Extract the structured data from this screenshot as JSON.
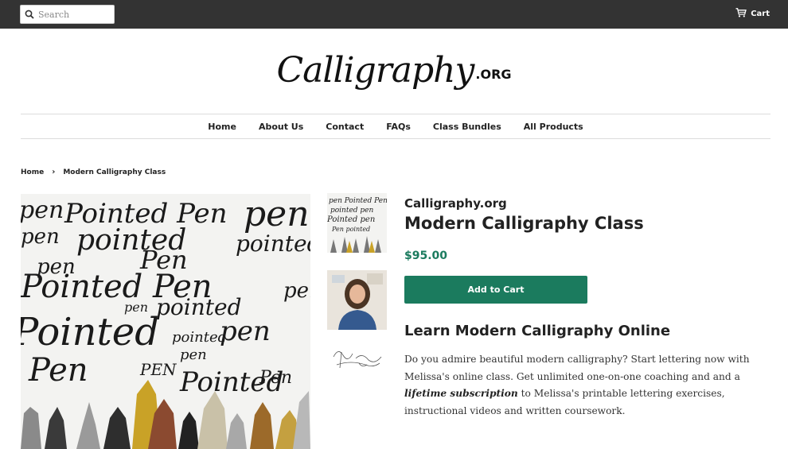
{
  "topbar": {
    "search": {
      "placeholder": "Search",
      "icon": "search-icon"
    },
    "cart": {
      "label": "Cart",
      "icon": "cart-icon"
    }
  },
  "logo": {
    "script_text": "Calligraphy",
    "suffix": ".ORG"
  },
  "nav": {
    "items": [
      {
        "label": "Home"
      },
      {
        "label": "About Us"
      },
      {
        "label": "Contact"
      },
      {
        "label": "FAQs"
      },
      {
        "label": "Class Bundles"
      },
      {
        "label": "All Products"
      }
    ]
  },
  "breadcrumb": {
    "home": "Home",
    "separator": "›",
    "current": "Modern Calligraphy Class"
  },
  "product": {
    "vendor": "Calligraphy.org",
    "title": "Modern Calligraphy Class",
    "price": "$95.00",
    "add_to_cart": "Add to Cart",
    "subheading": "Learn Modern Calligraphy Online",
    "description": {
      "part1": "Do you admire beautiful modern calligraphy? Start lettering now with Melissa's online class. Get unlimited one-on-one coaching and and a ",
      "emphasis": "lifetime subscription",
      "part2": " to Melissa's printable lettering exercises, instructional videos and written coursework."
    },
    "main_image": {
      "script_words": [
        "pen",
        "Pointed Pen",
        "pen",
        "pen",
        "pointed",
        "pointed",
        "pen",
        "Pen",
        "Pointed Pen",
        "pen",
        "pen",
        "pointed",
        "Pointed",
        "pointed",
        "pen",
        "pen",
        "Pen",
        "PEN",
        "Pointed",
        "Pen"
      ]
    }
  },
  "colors": {
    "topbar": "#333333",
    "accent": "#1b7b5e",
    "text": "#222222"
  }
}
